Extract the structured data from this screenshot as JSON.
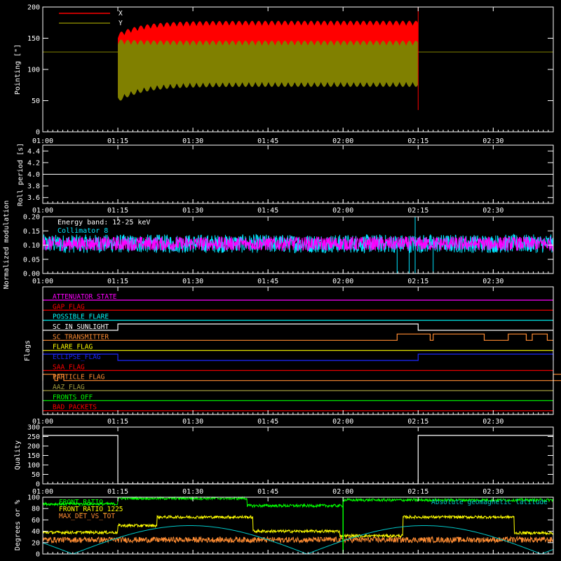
{
  "chart_data": [
    {
      "type": "area",
      "ylabel": "Pointing [\"]",
      "ylim": [
        0,
        200
      ],
      "yticks": [
        0,
        50,
        100,
        150,
        200
      ],
      "xlim_hours": [
        1.0,
        2.7
      ],
      "xticks": [
        "01:00",
        "01:15",
        "01:30",
        "01:45",
        "02:00",
        "02:15",
        "02:30"
      ],
      "xtick_hours": [
        1.0,
        1.25,
        1.5,
        1.75,
        2.0,
        2.25,
        2.5
      ],
      "reference_y": 128,
      "band_start_hour": 1.25,
      "band_end_hour": 2.25,
      "series": [
        {
          "name": "X",
          "color": "#ff0000",
          "upper_start": 150,
          "upper_plateau": 170,
          "lower_start": 60,
          "lower_plateau": 100
        },
        {
          "name": "Y",
          "color": "#808000",
          "upper_start": 140,
          "upper_plateau": 138,
          "lower_start": 55,
          "lower_plateau": 80
        }
      ]
    },
    {
      "type": "line",
      "ylabel": "Roll period [s]",
      "ylim": [
        3.5,
        4.5
      ],
      "yticks": [
        3.6,
        3.8,
        4.0,
        4.2,
        4.4
      ],
      "ytick_labels": [
        "3.6",
        "3.8",
        "4.0",
        "4.2",
        "4.4"
      ],
      "xticks": [
        "01:00",
        "01:15",
        "01:30",
        "01:45",
        "02:00",
        "02:15",
        "02:30"
      ],
      "series": [
        {
          "name": "",
          "color": "#ffffff",
          "values": [
            4.0
          ]
        }
      ]
    },
    {
      "type": "line",
      "ylabel": "Normalized modulation",
      "ylim": [
        0,
        0.2
      ],
      "yticks": [
        0,
        0.05,
        0.1,
        0.15,
        0.2
      ],
      "ytick_labels": [
        "0.00",
        "0.05",
        "0.10",
        "0.15",
        "0.20"
      ],
      "annotation": "Energy band: 12-25 keV",
      "xticks": [
        "01:00",
        "01:15",
        "01:30",
        "01:45",
        "02:00",
        "02:15",
        "02:30"
      ],
      "mean_value": 0.105,
      "noise_amplitude": 0.025,
      "dropouts_hours": [
        2.18,
        2.22,
        2.3
      ],
      "spike_hour": 2.24,
      "series": [
        {
          "name": "Collimator 8",
          "color": "#00e5ff"
        },
        {
          "name": "",
          "color": "#ff00ff"
        }
      ]
    },
    {
      "type": "line",
      "ylabel": "Flags",
      "xticks": [
        "01:00",
        "01:15",
        "01:30",
        "01:45",
        "02:00",
        "02:15",
        "02:30"
      ],
      "series": [
        {
          "name": "ATTENUATOR_STATE",
          "color": "#ff00ff"
        },
        {
          "name": "GAP_FLAG",
          "color": "#ff0000"
        },
        {
          "name": "POSSIBLE_FLARE",
          "color": "#00ffff"
        },
        {
          "name": "SC_IN_SUNLIGHT",
          "color": "#ffffff",
          "on_intervals": [
            [
              1.25,
              2.25
            ]
          ]
        },
        {
          "name": "SC_TRANSMITTER",
          "color": "#ff8c32",
          "on_intervals": [
            [
              2.18,
              2.29
            ],
            [
              2.3,
              2.47
            ],
            [
              2.55,
              2.61
            ],
            [
              2.63,
              2.68
            ]
          ]
        },
        {
          "name": "FLARE_FLAG",
          "color": "#ffff00"
        },
        {
          "name": "ECLIPSE_FLAG",
          "color": "#1e28ff",
          "on_intervals": [
            [
              1.0,
              1.25
            ],
            [
              2.25,
              2.7
            ]
          ]
        },
        {
          "name": "SAA_FLAG",
          "color": "#ff0000"
        },
        {
          "name": "PARTICLE_FLAG",
          "color": "#ff8c32",
          "on_intervals": [
            [
              1.0,
              1.04
            ],
            [
              1.05,
              1.07
            ],
            [
              2.77,
              2.79
            ]
          ]
        },
        {
          "name": "AAZ_FLAG",
          "color": "#a09a3c"
        },
        {
          "name": "FRONTS_OFF",
          "color": "#00ff00"
        },
        {
          "name": "BAD_PACKETS",
          "color": "#ff0000"
        }
      ]
    },
    {
      "type": "line",
      "ylabel": "Quality",
      "ylim": [
        0,
        300
      ],
      "yticks": [
        0,
        50,
        100,
        150,
        200,
        250,
        300
      ],
      "xticks": [
        "01:00",
        "01:15",
        "01:30",
        "01:45",
        "02:00",
        "02:15",
        "02:30"
      ],
      "series": [
        {
          "name": "",
          "color": "#ffffff",
          "high_value": 256,
          "low_value": 0,
          "low_interval_hours": [
            1.25,
            2.25
          ]
        }
      ]
    },
    {
      "type": "line",
      "ylabel": "Degrees or %",
      "ylim": [
        0,
        100
      ],
      "yticks": [
        0,
        20,
        40,
        60,
        80,
        100
      ],
      "series": [
        {
          "name": "FRONT_RATIO",
          "color": "#00ff00"
        },
        {
          "name": "FRONT_RATIO_1225",
          "color": "#ffff00"
        },
        {
          "name": "MAX_DET_VS_TOT",
          "color": "#ff8c32"
        },
        {
          "name": "Absolute geomagnetic latitude",
          "color": "#00c8c8"
        }
      ]
    }
  ]
}
